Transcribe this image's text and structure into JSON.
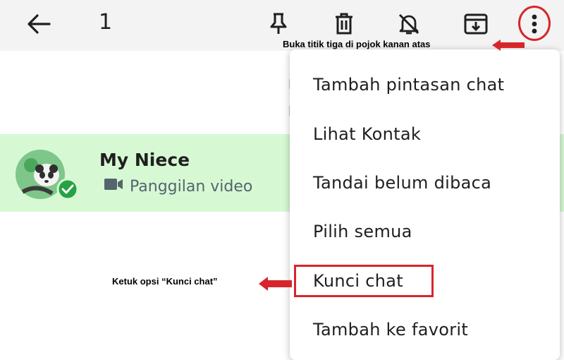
{
  "toolbar": {
    "selected_count": "1",
    "icons": [
      "back-arrow-icon",
      "pin-icon",
      "trash-icon",
      "mute-bell-icon",
      "archive-icon",
      "more-vert-icon"
    ]
  },
  "chat": {
    "name": "My Niece",
    "subtitle": "Panggilan video",
    "subtitle_icon": "video-camera-icon"
  },
  "menu": {
    "items": [
      {
        "label": "Tambah pintasan chat"
      },
      {
        "label": "Lihat Kontak"
      },
      {
        "label": "Tandai belum dibaca"
      },
      {
        "label": "Pilih semua"
      },
      {
        "label": "Kunci chat"
      },
      {
        "label": "Tambah ke favorit"
      }
    ]
  },
  "annotations": {
    "top": "Buka titik tiga di pojok kanan atas",
    "left": "Ketuk opsi “Kunci chat”"
  },
  "colors": {
    "highlight": "#d7262b",
    "chat_row": "#d6f9d3",
    "topbar": "#f3f3f3",
    "badge": "#25a244"
  }
}
